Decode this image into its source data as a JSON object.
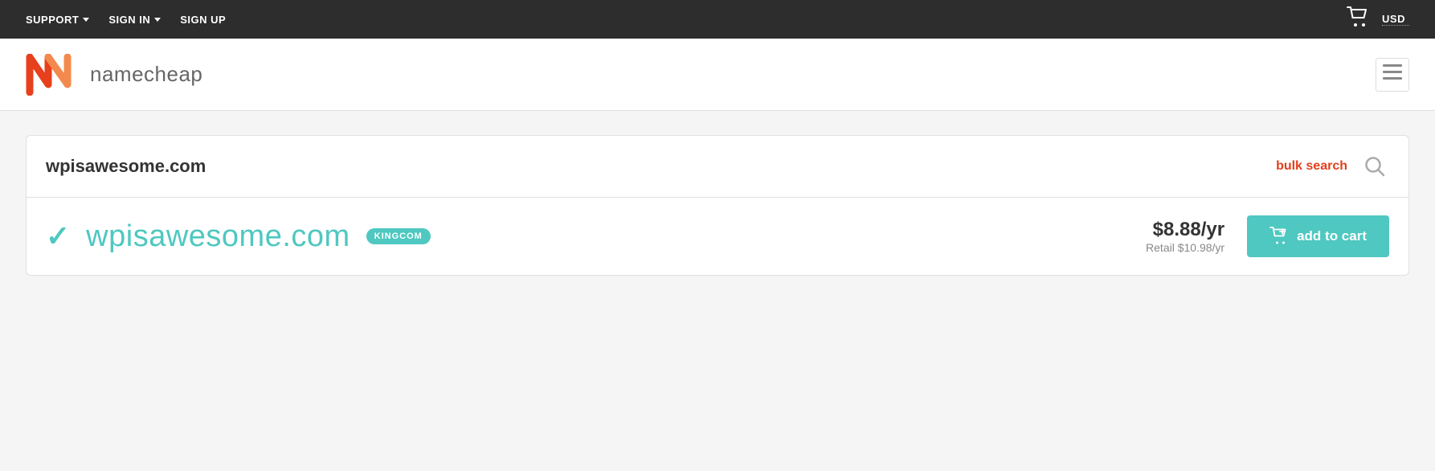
{
  "topnav": {
    "support_label": "SUPPORT",
    "signin_label": "SIGN IN",
    "signup_label": "SIGN UP",
    "currency_label": "USD"
  },
  "header": {
    "logo_text": "namecheap",
    "menu_icon_label": "☰"
  },
  "search": {
    "domain_value": "wpisawesome.com",
    "bulk_search_label": "bulk search",
    "search_icon": "🔍"
  },
  "result": {
    "domain": "wpisawesome.com",
    "badge": "KINGCOM",
    "price_main": "$8.88/yr",
    "price_retail": "Retail $10.98/yr",
    "add_to_cart_label": "add to cart"
  }
}
